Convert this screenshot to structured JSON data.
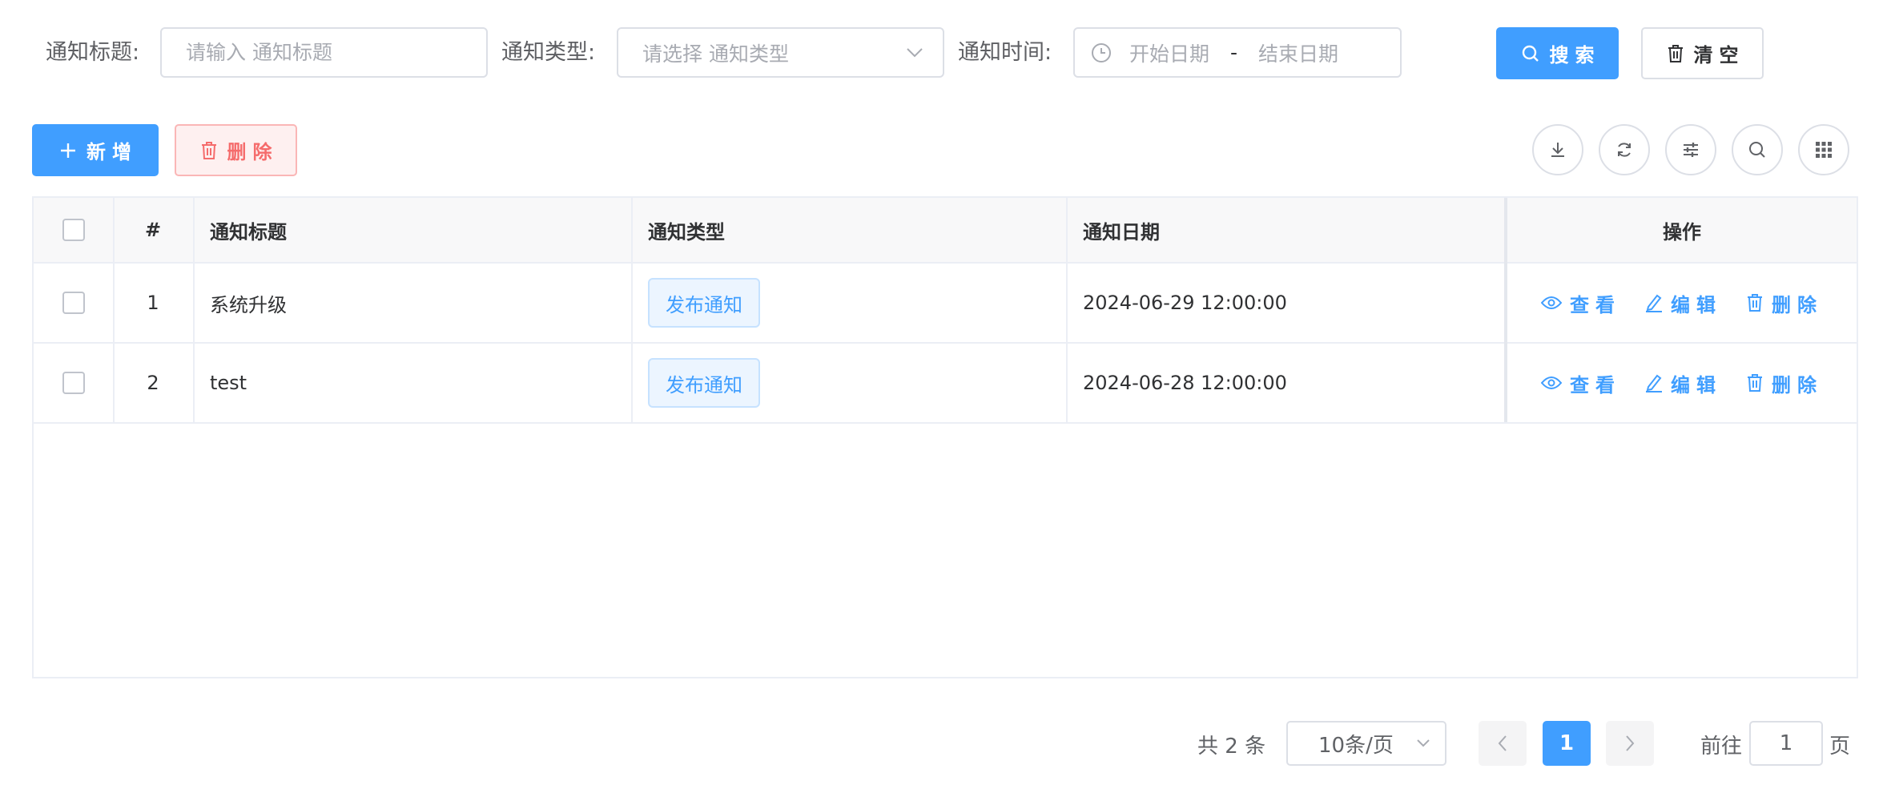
{
  "search_form": {
    "title_label": "通知标题:",
    "title_placeholder": "请输入 通知标题",
    "type_label": "通知类型:",
    "type_placeholder": "请选择 通知类型",
    "time_label": "通知时间:",
    "start_placeholder": "开始日期",
    "range_separator": "-",
    "end_placeholder": "结束日期",
    "search_button": "搜索",
    "clear_button": "清空"
  },
  "toolbar": {
    "add_button": "新增",
    "delete_button": "删除",
    "right_icons": [
      "download-icon",
      "refresh-icon",
      "column-settings-icon",
      "search-toggle-icon",
      "grid-icon"
    ]
  },
  "table": {
    "columns": {
      "index": "#",
      "title": "通知标题",
      "type": "通知类型",
      "date": "通知日期",
      "actions": "操作"
    },
    "rows": [
      {
        "index": "1",
        "title": "系统升级",
        "type": "发布通知",
        "date": "2024-06-29 12:00:00"
      },
      {
        "index": "2",
        "title": "test",
        "type": "发布通知",
        "date": "2024-06-28 12:00:00"
      }
    ],
    "actions": {
      "view": "查看",
      "edit": "编辑",
      "delete": "删除"
    }
  },
  "pagination": {
    "total_text": "共 2 条",
    "page_size": "10条/页",
    "current_page": "1",
    "goto_label": "前往",
    "goto_value": "1",
    "page_suffix": "页"
  },
  "colors": {
    "primary": "#409eff",
    "danger": "#f56c6c",
    "border": "#dcdfe6"
  }
}
